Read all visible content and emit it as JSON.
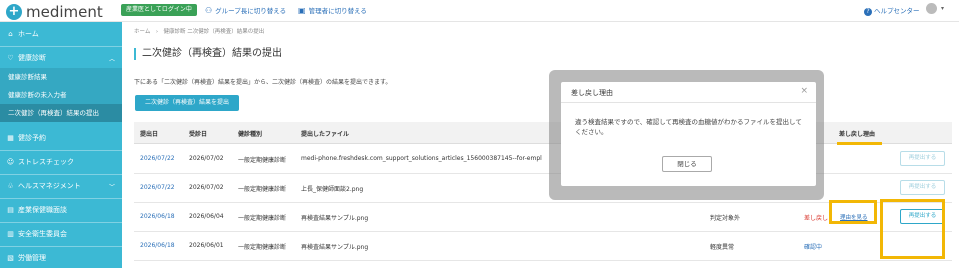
{
  "header": {
    "logo_text": "mediment",
    "login_badge": "産業医としてログイン中",
    "switch_group": "グループ長に切り替える",
    "switch_admin": "管理者に切り替える",
    "help": "ヘルプセンター"
  },
  "sidebar": {
    "items": [
      {
        "label": "ホーム",
        "icon": "home-icon"
      },
      {
        "label": "健康診断",
        "icon": "health-check-icon"
      },
      {
        "label": "健診予約",
        "icon": "calendar-icon"
      },
      {
        "label": "ストレスチェック",
        "icon": "stress-check-icon"
      },
      {
        "label": "ヘルスマネジメント",
        "icon": "health-management-icon"
      },
      {
        "label": "産業保健職面談",
        "icon": "interview-icon"
      },
      {
        "label": "安全衛生委員会",
        "icon": "committee-icon"
      },
      {
        "label": "労働管理",
        "icon": "labor-icon"
      }
    ],
    "subitems": [
      {
        "label": "健康診断結果"
      },
      {
        "label": "健康診断の未入力者"
      },
      {
        "label": "二次健診（再検査）結果の提出"
      }
    ]
  },
  "main": {
    "breadcrumb": "ホーム　›　健康診断 二次健診（再検査）結果の提出",
    "title": "二次健診（再検査）結果の提出",
    "description": "下にある「二次健診（再検査）結果を提出」から、二次健診（再検査）の結果を提出できます。",
    "submit_button": "二次健診（再検査）結果を提出",
    "table": {
      "headers": [
        "提出日",
        "受診日",
        "健診種別",
        "提出したファイル",
        "差し戻し理由"
      ],
      "rows": [
        {
          "submitted": "2026/07/22",
          "exam_date": "2026/07/02",
          "type": "一般定期健康診断",
          "file": "medi-phone.freshdesk.com_support_solutions_articles_156000387145--for-empl",
          "judgement": "",
          "status": "",
          "reason_link": "",
          "action": "再提出する",
          "action_active": false
        },
        {
          "submitted": "2026/07/22",
          "exam_date": "2026/07/02",
          "type": "一般定期健康診断",
          "file": "上長_保健師面談2.png",
          "judgement": "",
          "status": "",
          "reason_link": "",
          "action": "再提出する",
          "action_active": false
        },
        {
          "submitted": "2026/06/18",
          "exam_date": "2026/06/04",
          "type": "一般定期健康診断",
          "file": "再検査結果サンプル.png",
          "judgement": "判定対象外",
          "status": "差し戻し",
          "reason_link": "理由を見る",
          "action": "再提出する",
          "action_active": true
        },
        {
          "submitted": "2026/06/18",
          "exam_date": "2026/06/01",
          "type": "一般定期健康診断",
          "file": "再検査結果サンプル.png",
          "judgement": "軽度異常",
          "status": "確認中",
          "reason_link": "",
          "action": "再提出する",
          "action_active": false
        }
      ]
    }
  },
  "modal": {
    "title": "差し戻し理由",
    "body": "違う検査結果ですので、確認して再検査の血糖値がわかるファイルを提出してください。",
    "close_button": "閉じる"
  },
  "colors": {
    "sidebar": "#3cb9d4",
    "primary": "#2ea7c9",
    "highlight": "#f2b705",
    "danger": "#d9342b"
  }
}
